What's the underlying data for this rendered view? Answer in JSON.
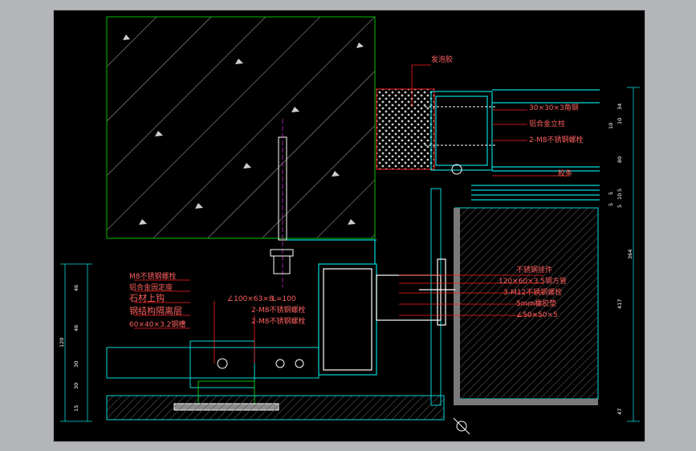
{
  "colors": {
    "background": "#000000",
    "frame": "#b3b5b8",
    "leader_red": "#ff2020",
    "cyan": "#00d8d8",
    "white": "#ffffff",
    "green": "#00c000",
    "magenta": "#ff40ff",
    "yellow": "#ffff00",
    "gray_fill": "#6a6a6a"
  },
  "labels_right": {
    "top_tag": "发泡胶",
    "angle_steel": "30×30×3角钢",
    "alu_mullion": "铝合金立柱",
    "bolt_upper": "2-M8不锈钢螺栓",
    "sealant": "胶条"
  },
  "labels_mid": {
    "ss_pin": "不锈钢挂件",
    "steel_tube": "120×60×3.5钢方管",
    "bolt_m12": "3-M12不锈钢螺栓",
    "rubber_pad": "5mm橡胶垫",
    "angle_steel_2": "∠50×50×5"
  },
  "labels_left": {
    "bolt_m8": "M8不锈钢螺栓",
    "alu_bracket": "铝合金固定座",
    "stone_hook": "石材上钩",
    "insulation": "钢结构隔离层",
    "channel_steel": "60×40×3.2钢槽"
  },
  "labels_center": {
    "angle_100": "∠100×63×8",
    "length": "L=100",
    "bolt_a": "2-M8不锈钢螺栓",
    "bolt_b": "2-M8不锈钢螺栓"
  },
  "dims_right": [
    "34",
    "10",
    "10",
    "80",
    "5",
    "10",
    "5",
    "5",
    "5",
    "364",
    "417",
    "47"
  ],
  "dims_left": [
    "46",
    "46",
    "120",
    "30",
    "30",
    "15"
  ]
}
